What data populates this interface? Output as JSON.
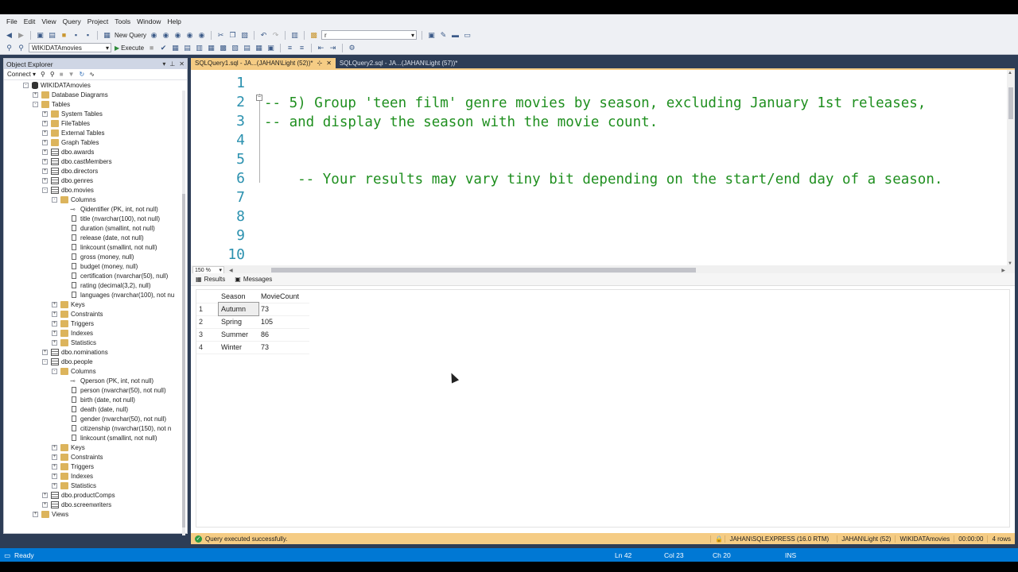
{
  "menu": [
    "File",
    "Edit",
    "View",
    "Query",
    "Project",
    "Tools",
    "Window",
    "Help"
  ],
  "toolbar": {
    "new_query": "New Query",
    "search_value": "r",
    "database": "WIKIDATAmovies",
    "execute": "Execute"
  },
  "object_explorer": {
    "title": "Object Explorer",
    "connect": "Connect",
    "tree": [
      {
        "label": "WIKIDATAmovies",
        "indent": 0,
        "icon": "database-icon",
        "exp": "-"
      },
      {
        "label": "Database Diagrams",
        "indent": 1,
        "icon": "folder-icon",
        "exp": "+"
      },
      {
        "label": "Tables",
        "indent": 1,
        "icon": "folder-icon",
        "exp": "-"
      },
      {
        "label": "System Tables",
        "indent": 2,
        "icon": "folder-icon",
        "exp": "+"
      },
      {
        "label": "FileTables",
        "indent": 2,
        "icon": "folder-icon",
        "exp": "+"
      },
      {
        "label": "External Tables",
        "indent": 2,
        "icon": "folder-icon",
        "exp": "+"
      },
      {
        "label": "Graph Tables",
        "indent": 2,
        "icon": "folder-icon",
        "exp": "+"
      },
      {
        "label": "dbo.awards",
        "indent": 2,
        "icon": "table-icon",
        "exp": "+"
      },
      {
        "label": "dbo.castMembers",
        "indent": 2,
        "icon": "table-icon",
        "exp": "+"
      },
      {
        "label": "dbo.directors",
        "indent": 2,
        "icon": "table-icon",
        "exp": "+"
      },
      {
        "label": "dbo.genres",
        "indent": 2,
        "icon": "table-icon",
        "exp": "+"
      },
      {
        "label": "dbo.movies",
        "indent": 2,
        "icon": "table-icon",
        "exp": "-"
      },
      {
        "label": "Columns",
        "indent": 3,
        "icon": "folder-icon",
        "exp": "-"
      },
      {
        "label": "Qidentifier (PK, int, not null)",
        "indent": 4,
        "icon": "key-icon",
        "exp": ""
      },
      {
        "label": "title (nvarchar(100), not null)",
        "indent": 4,
        "icon": "column-icon",
        "exp": ""
      },
      {
        "label": "duration (smallint, not null)",
        "indent": 4,
        "icon": "column-icon",
        "exp": ""
      },
      {
        "label": "release (date, not null)",
        "indent": 4,
        "icon": "column-icon",
        "exp": ""
      },
      {
        "label": "linkcount (smallint, not null)",
        "indent": 4,
        "icon": "column-icon",
        "exp": ""
      },
      {
        "label": "gross (money, null)",
        "indent": 4,
        "icon": "column-icon",
        "exp": ""
      },
      {
        "label": "budget (money, null)",
        "indent": 4,
        "icon": "column-icon",
        "exp": ""
      },
      {
        "label": "certification (nvarchar(50), null)",
        "indent": 4,
        "icon": "column-icon",
        "exp": ""
      },
      {
        "label": "rating (decimal(3,2), null)",
        "indent": 4,
        "icon": "column-icon",
        "exp": ""
      },
      {
        "label": "languages (nvarchar(100), not nu",
        "indent": 4,
        "icon": "column-icon",
        "exp": ""
      },
      {
        "label": "Keys",
        "indent": 3,
        "icon": "folder-icon",
        "exp": "+"
      },
      {
        "label": "Constraints",
        "indent": 3,
        "icon": "folder-icon",
        "exp": "+"
      },
      {
        "label": "Triggers",
        "indent": 3,
        "icon": "folder-icon",
        "exp": "+"
      },
      {
        "label": "Indexes",
        "indent": 3,
        "icon": "folder-icon",
        "exp": "+"
      },
      {
        "label": "Statistics",
        "indent": 3,
        "icon": "folder-icon",
        "exp": "+"
      },
      {
        "label": "dbo.nominations",
        "indent": 2,
        "icon": "table-icon",
        "exp": "+"
      },
      {
        "label": "dbo.people",
        "indent": 2,
        "icon": "table-icon",
        "exp": "-"
      },
      {
        "label": "Columns",
        "indent": 3,
        "icon": "folder-icon",
        "exp": "-"
      },
      {
        "label": "Qperson (PK, int, not null)",
        "indent": 4,
        "icon": "key-icon",
        "exp": ""
      },
      {
        "label": "person (nvarchar(50), not null)",
        "indent": 4,
        "icon": "column-icon",
        "exp": ""
      },
      {
        "label": "birth (date, not null)",
        "indent": 4,
        "icon": "column-icon",
        "exp": ""
      },
      {
        "label": "death (date, null)",
        "indent": 4,
        "icon": "column-icon",
        "exp": ""
      },
      {
        "label": "gender (nvarchar(50), not null)",
        "indent": 4,
        "icon": "column-icon",
        "exp": ""
      },
      {
        "label": "citizenship (nvarchar(150), not n",
        "indent": 4,
        "icon": "column-icon",
        "exp": ""
      },
      {
        "label": "linkcount (smallint, not null)",
        "indent": 4,
        "icon": "column-icon",
        "exp": ""
      },
      {
        "label": "Keys",
        "indent": 3,
        "icon": "folder-icon",
        "exp": "+"
      },
      {
        "label": "Constraints",
        "indent": 3,
        "icon": "folder-icon",
        "exp": "+"
      },
      {
        "label": "Triggers",
        "indent": 3,
        "icon": "folder-icon",
        "exp": "+"
      },
      {
        "label": "Indexes",
        "indent": 3,
        "icon": "folder-icon",
        "exp": "+"
      },
      {
        "label": "Statistics",
        "indent": 3,
        "icon": "folder-icon",
        "exp": "+"
      },
      {
        "label": "dbo.productComps",
        "indent": 2,
        "icon": "table-icon",
        "exp": "+"
      },
      {
        "label": "dbo.screenwriters",
        "indent": 2,
        "icon": "table-icon",
        "exp": "+"
      },
      {
        "label": "Views",
        "indent": 1,
        "icon": "folder-icon",
        "exp": "+"
      }
    ]
  },
  "tabs": [
    {
      "label": "SQLQuery1.sql - JA...(JAHAN\\Light (52))*",
      "active": true
    },
    {
      "label": "SQLQuery2.sql - JA...(JAHAN\\Light (57))*",
      "active": false
    }
  ],
  "editor": {
    "lines": [
      {
        "num": "1",
        "text": ""
      },
      {
        "num": "2",
        "text": "-- 5) Group 'teen film' genre movies by season, excluding January 1st releases,"
      },
      {
        "num": "3",
        "text": "-- and display the season with the movie count."
      },
      {
        "num": "4",
        "text": ""
      },
      {
        "num": "5",
        "text": ""
      },
      {
        "num": "6",
        "text": "    -- Your results may vary tiny bit depending on the start/end day of a season."
      },
      {
        "num": "7",
        "text": ""
      },
      {
        "num": "8",
        "text": ""
      },
      {
        "num": "9",
        "text": ""
      },
      {
        "num": "10",
        "text": ""
      }
    ],
    "zoom": "150 %"
  },
  "results": {
    "tab_results": "Results",
    "tab_messages": "Messages",
    "columns": [
      "Season",
      "MovieCount"
    ],
    "rows": [
      {
        "n": "1",
        "season": "Autumn",
        "count": "73"
      },
      {
        "n": "2",
        "season": "Spring",
        "count": "105"
      },
      {
        "n": "3",
        "season": "Summer",
        "count": "86"
      },
      {
        "n": "4",
        "season": "Winter",
        "count": "73"
      }
    ]
  },
  "query_status": {
    "message": "Query executed successfully.",
    "server": "JAHAN\\SQLEXPRESS (16.0 RTM)",
    "user": "JAHAN\\Light (52)",
    "database": "WIKIDATAmovies",
    "elapsed": "00:00:00",
    "rows": "4 rows"
  },
  "statusbar": {
    "ready": "Ready",
    "ln": "Ln 42",
    "col": "Col 23",
    "ch": "Ch 20",
    "mode": "INS"
  },
  "colors": {
    "accent": "#f5cc84",
    "shell": "#2d3d56",
    "statusbar": "#0078d4",
    "comment": "#1f8f1f",
    "line_number": "#2b91af"
  }
}
